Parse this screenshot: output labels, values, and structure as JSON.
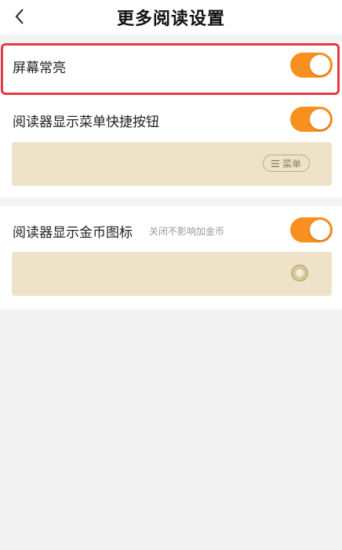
{
  "header": {
    "title": "更多阅读设置"
  },
  "settings": {
    "screen_on": {
      "label": "屏幕常亮",
      "enabled": true
    },
    "menu_shortcut": {
      "label": "阅读器显示菜单快捷按钮",
      "enabled": true,
      "preview_chip": "菜单"
    },
    "coin_icon": {
      "label": "阅读器显示金币图标",
      "note": "关闭不影响加金币",
      "enabled": true
    }
  },
  "colors": {
    "accent": "#f7901e",
    "highlight": "#e63946",
    "preview_bg": "#eee3c8"
  }
}
